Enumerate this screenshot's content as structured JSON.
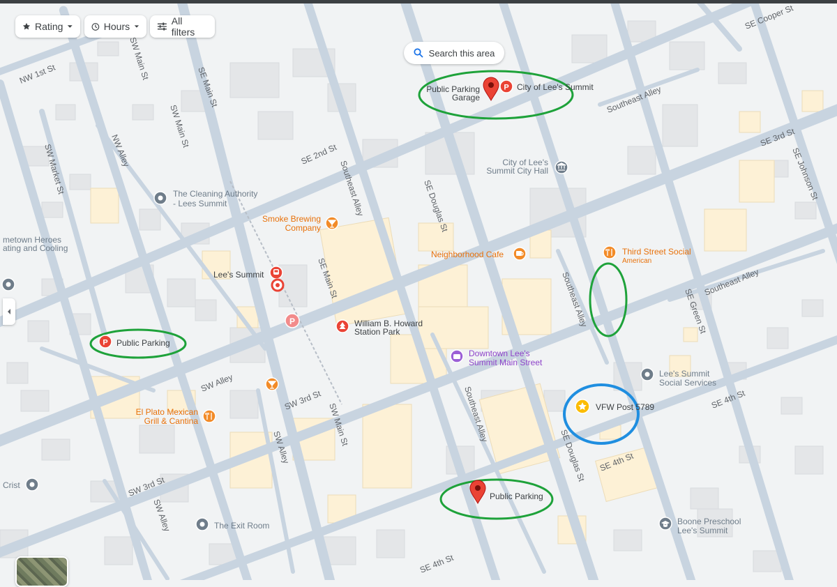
{
  "filters": {
    "rating": "Rating",
    "hours": "Hours",
    "all_filters": "All filters"
  },
  "search_area": "Search this area",
  "streets": {
    "nw_1st": "NW 1st St",
    "sw_main_1": "SW Main St",
    "sw_main_2": "SW Main St",
    "se_main_1": "SE Main St",
    "se_main_2": "SE Main St",
    "sw_main_3": "SW Main St",
    "nw_alley": "NW Alley",
    "sw_market": "SW Market St",
    "se_2nd": "SE 2nd St",
    "se_3rd_1": "SE 3rd St",
    "sw_3rd_1": "SW 3rd St",
    "sw_3rd_2": "SW 3rd St",
    "se_4th_1": "SE 4th St",
    "se_4th_2": "SE 4th St",
    "se_4th_3": "SE 4th St",
    "se_douglas_1": "SE Douglas St",
    "se_douglas_2": "SE Douglas St",
    "se_green": "SE Green St",
    "se_johnson": "SE Johnson St",
    "se_cooper": "SE Cooper St",
    "southeast_alley_1": "Southeast Alley",
    "southeast_alley_2": "Southeast Alley",
    "southeast_alley_3": "Southeast Alley",
    "southeast_alley_4": "Southeast Alley",
    "southeast_alley_5": "Southeast Alley",
    "sw_alley_1": "SW Alley",
    "sw_alley_2": "SW Alley",
    "sw_alley_3": "SW Alley"
  },
  "places": {
    "parking_garage": "Public Parking\nGarage",
    "city_lees_summit": "City of Lee's Summit",
    "city_hall": "City of Lee's\nSummit City Hall",
    "cleaning_authority": "The Cleaning Authority\n- Lees Summit",
    "smoke_brewing": "Smoke Brewing\nCompany",
    "neighborhood_cafe": "Neighborhood Cafe",
    "third_street_social": "Third Street Social",
    "third_street_social_sub": "American",
    "hometown_heroes": "metown Heroes\nating and Cooling",
    "lees_summit_station": "Lee's Summit",
    "public_parking_west": "Public Parking",
    "william_howard_park": "William B. Howard\nStation Park",
    "downtown_main_street": "Downtown Lee's\nSummit Main Street",
    "social_services": "Lee's Summit\nSocial Services",
    "vfw_post": "VFW Post 5789",
    "el_plato": "El Plato Mexican\nGrill & Cantina",
    "crist": "Crist",
    "exit_room": "The Exit Room",
    "public_parking_south": "Public Parking",
    "boone_preschool": "Boone Preschool\nLee's Summit"
  },
  "colors": {
    "map_bg": "#f1f3f4",
    "road": "#c8d4e0",
    "block": "#e3e5e7",
    "building_tan": "#fdf1d6",
    "pin_red": "#ea4335",
    "food_orange": "#f28b28",
    "poi_gray": "#6f7d8a",
    "highlight_green": "#1ea23a",
    "highlight_blue": "#1f8ee0",
    "purple": "#9b5fd6"
  }
}
